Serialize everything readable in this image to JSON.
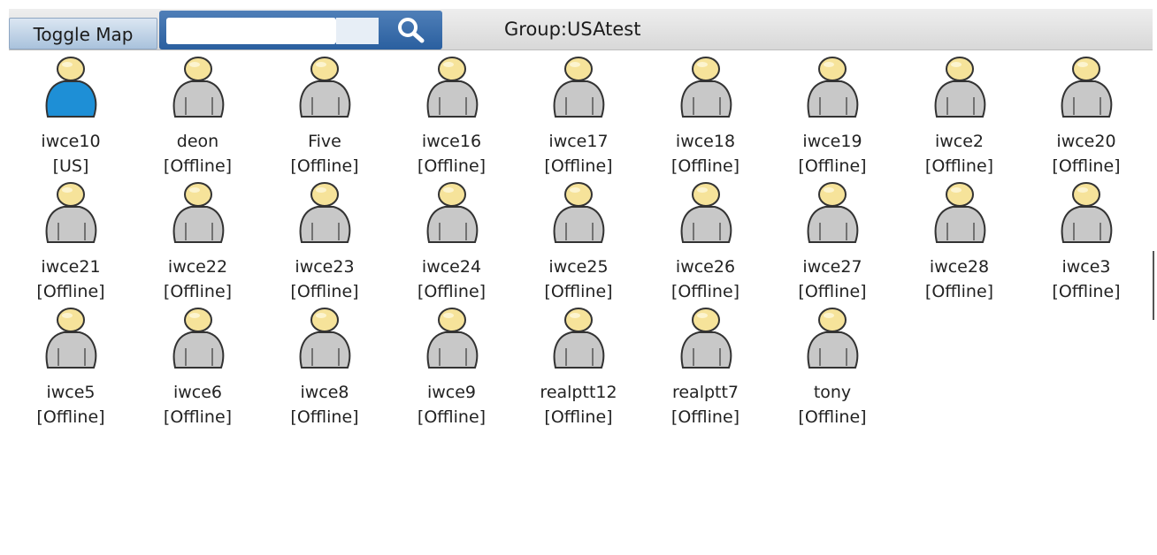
{
  "toolbar": {
    "toggle_map_label": "Toggle Map",
    "search_value": "",
    "search_icon": "search-icon",
    "group_label": "Group:USAtest"
  },
  "colors": {
    "online_body": "#1e8fd6",
    "offline_body": "#c8c8c8",
    "head": "#f6e39a"
  },
  "users": [
    {
      "name": "iwce10",
      "status": "[US]",
      "online": true
    },
    {
      "name": "deon",
      "status": "[Offline]",
      "online": false
    },
    {
      "name": "Five",
      "status": "[Offline]",
      "online": false
    },
    {
      "name": "iwce16",
      "status": "[Offline]",
      "online": false
    },
    {
      "name": "iwce17",
      "status": "[Offline]",
      "online": false
    },
    {
      "name": "iwce18",
      "status": "[Offline]",
      "online": false
    },
    {
      "name": "iwce19",
      "status": "[Offline]",
      "online": false
    },
    {
      "name": "iwce2",
      "status": "[Offline]",
      "online": false
    },
    {
      "name": "iwce20",
      "status": "[Offline]",
      "online": false
    },
    {
      "name": "iwce21",
      "status": "[Offline]",
      "online": false
    },
    {
      "name": "iwce22",
      "status": "[Offline]",
      "online": false
    },
    {
      "name": "iwce23",
      "status": "[Offline]",
      "online": false
    },
    {
      "name": "iwce24",
      "status": "[Offline]",
      "online": false
    },
    {
      "name": "iwce25",
      "status": "[Offline]",
      "online": false
    },
    {
      "name": "iwce26",
      "status": "[Offline]",
      "online": false
    },
    {
      "name": "iwce27",
      "status": "[Offline]",
      "online": false
    },
    {
      "name": "iwce28",
      "status": "[Offline]",
      "online": false
    },
    {
      "name": "iwce3",
      "status": "[Offline]",
      "online": false
    },
    {
      "name": "iwce5",
      "status": "[Offline]",
      "online": false
    },
    {
      "name": "iwce6",
      "status": "[Offline]",
      "online": false
    },
    {
      "name": "iwce8",
      "status": "[Offline]",
      "online": false
    },
    {
      "name": "iwce9",
      "status": "[Offline]",
      "online": false
    },
    {
      "name": "realptt12",
      "status": "[Offline]",
      "online": false
    },
    {
      "name": "realptt7",
      "status": "[Offline]",
      "online": false
    },
    {
      "name": "tony",
      "status": "[Offline]",
      "online": false
    }
  ]
}
